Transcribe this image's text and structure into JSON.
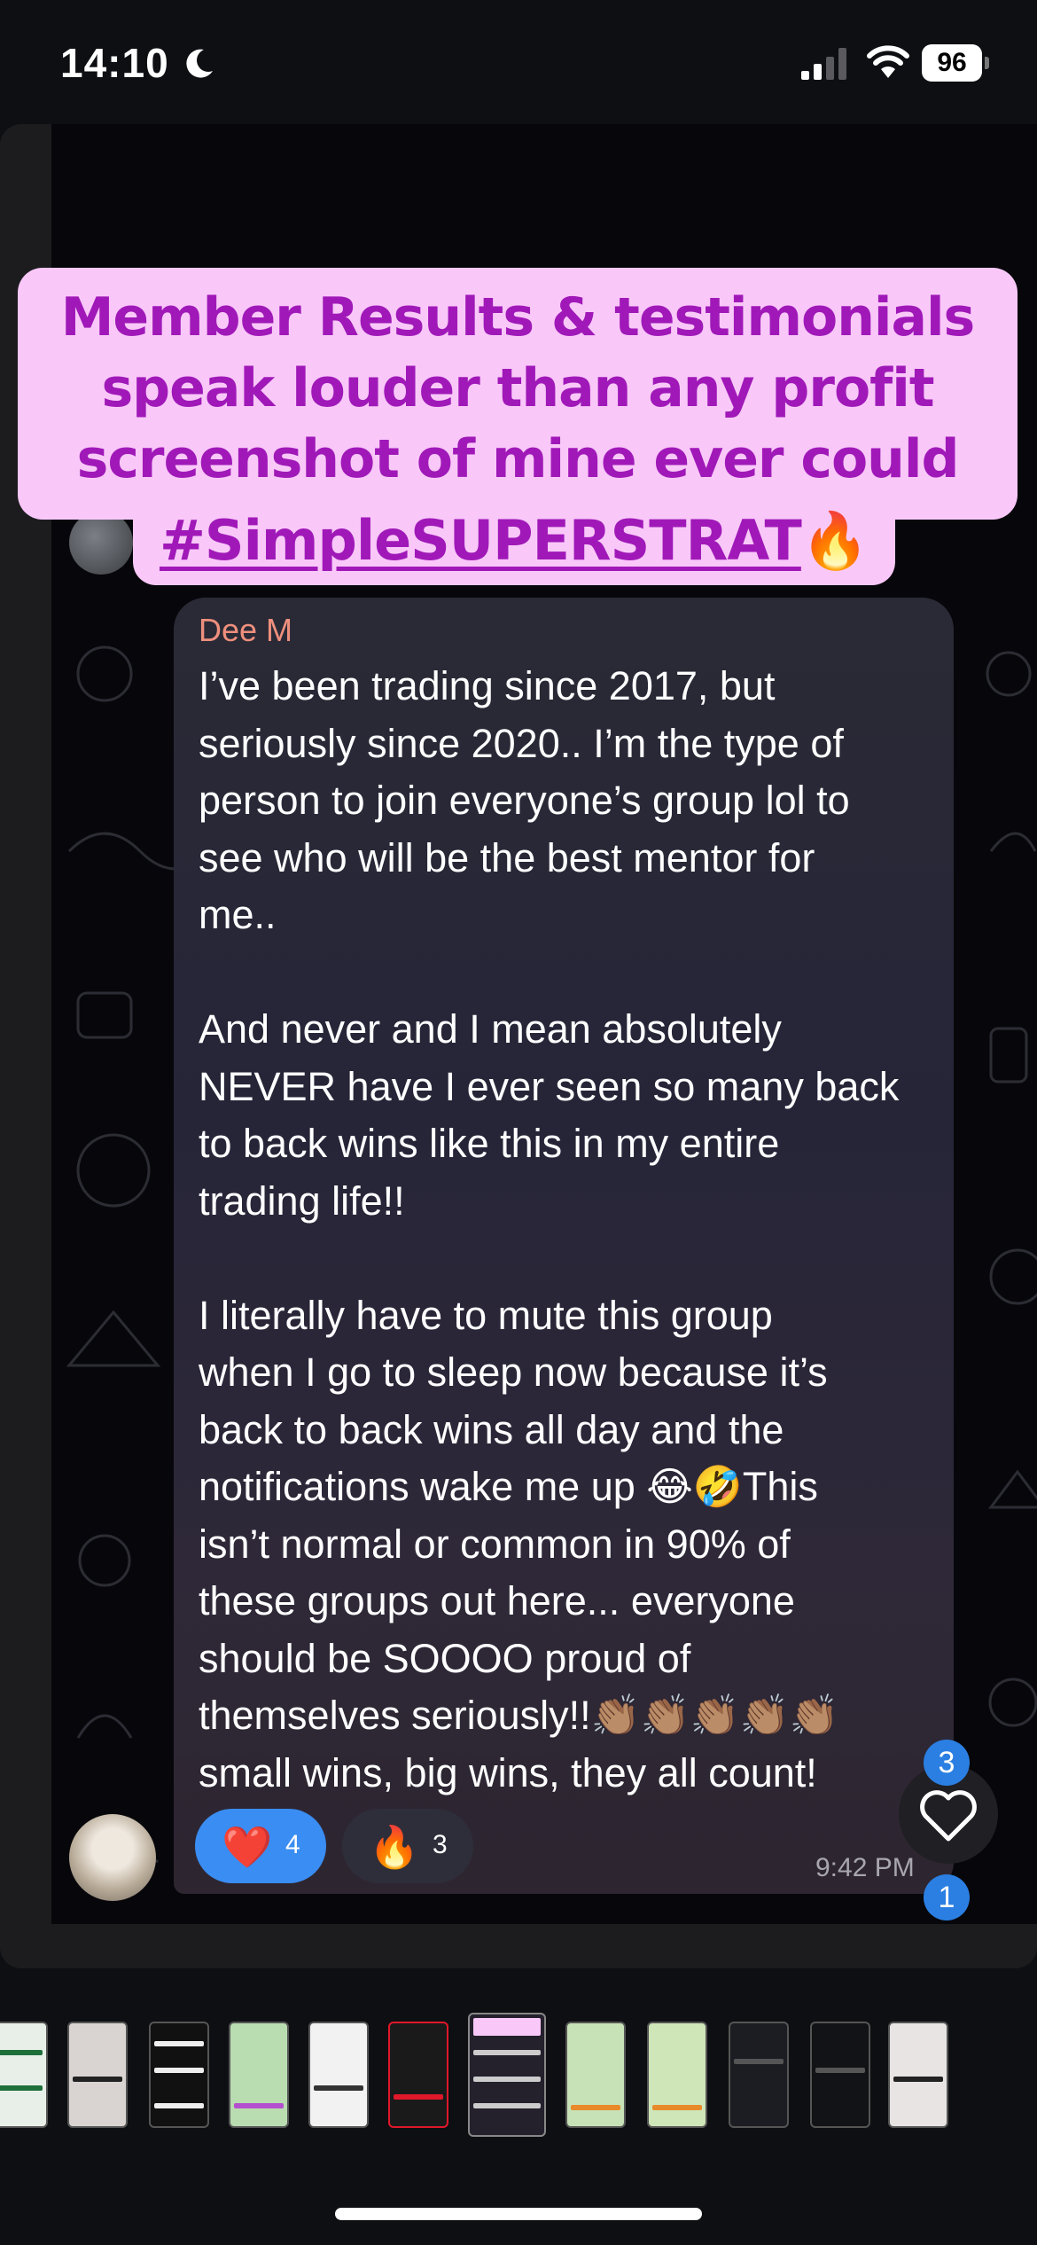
{
  "status_bar": {
    "time": "14:10",
    "battery": "96",
    "icons": [
      "moon-icon",
      "signal-icon",
      "wifi-icon",
      "battery-icon"
    ]
  },
  "headline": {
    "line1": "Member Results & testimonials",
    "line2": "speak louder than any profit",
    "line3": "screenshot of mine ever could",
    "hashtag": "#SimpleSUPERSTRAT",
    "hashtag_emoji": "🔥",
    "color": "#a019b8",
    "background": "#f9c8f9"
  },
  "message": {
    "sender": "Dee M",
    "text": "I’ve been trading since 2017, but\nseriously since 2020.. I’m the type of\nperson to join everyone’s group lol to\nsee who will be the best mentor for\nme..\n\nAnd never and I mean absolutely\nNEVER have I ever seen so many back\nto back wins like this in my entire\ntrading life!!\n\nI literally have to mute this group\nwhen I go to sleep now because it’s\nback to back wins all day and the\nnotifications wake me up 😂🤣This\nisn’t normal or common in 90% of\nthese groups out here... everyone\nshould be SOOOO proud of\nthemselves seriously!!👏🏽👏🏽👏🏽👏🏽👏🏽\nsmall wins, big wins, they all count!",
    "time": "9:42 PM",
    "reactions": [
      {
        "icon": "❤️",
        "name": "heart-reaction",
        "count": "4"
      },
      {
        "icon": "🔥",
        "name": "fire-reaction",
        "count": "3"
      }
    ]
  },
  "story_actions": {
    "like_count": "3",
    "comment_count": "1"
  },
  "colors": {
    "accent_blue": "#2b7fe2",
    "sender_name": "#ee8f7d"
  }
}
